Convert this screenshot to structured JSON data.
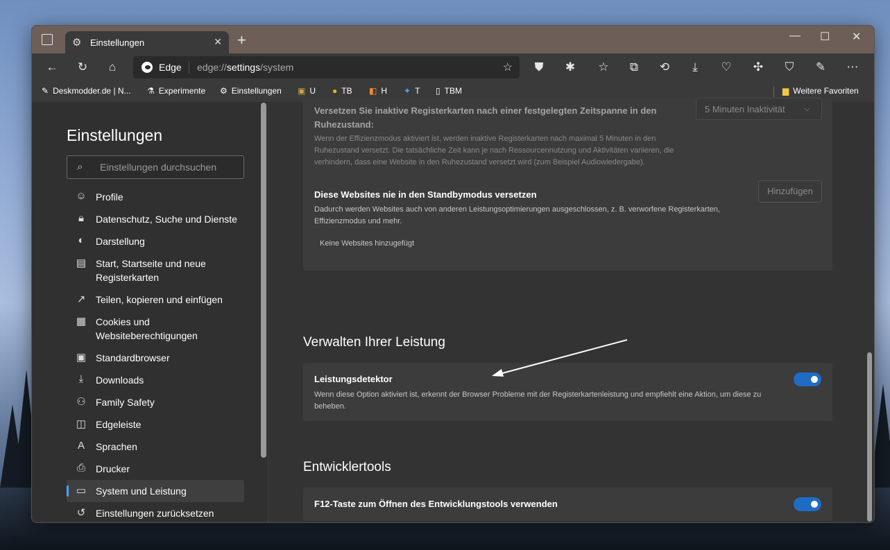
{
  "browser": {
    "tab_title": "Einstellungen",
    "window_controls": [
      "—",
      "☐",
      "✕"
    ],
    "address": {
      "brand": "Edge",
      "url_prefix": "edge://",
      "url_bold": "settings",
      "url_suffix": "/system"
    }
  },
  "favorites": [
    {
      "label": "Deskmodder.de | N...",
      "icon": "pen-icon"
    },
    {
      "label": "Experimente",
      "icon": "flask-icon"
    },
    {
      "label": "Einstellungen",
      "icon": "gear-icon"
    },
    {
      "label": "U",
      "icon": "extension-icon"
    },
    {
      "label": "TB",
      "icon": "coin-icon"
    },
    {
      "label": "H",
      "icon": "squares-icon"
    },
    {
      "label": "T",
      "icon": "twitter-icon"
    },
    {
      "label": "TBM",
      "icon": "page-icon"
    }
  ],
  "favorites_folder": "Weitere Favoriten",
  "sidebar": {
    "title": "Einstellungen",
    "search_placeholder": "Einstellungen durchsuchen",
    "items": [
      {
        "label": "Profile",
        "icon": "profile-icon"
      },
      {
        "label": "Datenschutz, Suche und Dienste",
        "icon": "lock-icon"
      },
      {
        "label": "Darstellung",
        "icon": "palette-icon"
      },
      {
        "label": "Start, Startseite und neue Registerkarten",
        "icon": "home-tabs-icon"
      },
      {
        "label": "Teilen, kopieren und einfügen",
        "icon": "share-icon"
      },
      {
        "label": "Cookies und Websiteberechtigungen",
        "icon": "cookie-icon"
      },
      {
        "label": "Standardbrowser",
        "icon": "browser-icon"
      },
      {
        "label": "Downloads",
        "icon": "download-icon"
      },
      {
        "label": "Family Safety",
        "icon": "family-icon"
      },
      {
        "label": "Edgeleiste",
        "icon": "sidebar-icon"
      },
      {
        "label": "Sprachen",
        "icon": "language-icon"
      },
      {
        "label": "Drucker",
        "icon": "printer-icon"
      },
      {
        "label": "System und Leistung",
        "icon": "laptop-icon",
        "active": true
      },
      {
        "label": "Einstellungen zurücksetzen",
        "icon": "reset-icon"
      }
    ]
  },
  "main": {
    "sleeping_tabs": {
      "title": "Versetzen Sie inaktive Registerkarten nach einer festgelegten Zeitspanne in den Ruhezustand:",
      "desc": "Wenn der Effizienzmodus aktiviert ist, werden inaktive Registerkarten nach maximal 5 Minuten in den Ruhezustand versetzt. Die tatsächliche Zeit kann je nach Ressourcennutzung und Aktivitäten variieren, die verhindern, dass eine Website in den Ruhezustand versetzt wird (zum Beispiel Audiowiedergabe).",
      "dropdown_value": "5 Minuten Inaktivität"
    },
    "never_sleep": {
      "title": "Diese Websites nie in den Standbymodus versetzen",
      "desc": "Dadurch werden Websites auch von anderen Leistungsoptimierungen ausgeschlossen, z. B. verworfene Registerkarten, Effizienzmodus und mehr.",
      "add_button": "Hinzufügen",
      "empty_text": "Keine Websites hinzugefügt"
    },
    "performance": {
      "heading": "Verwalten Ihrer Leistung",
      "title": "Leistungsdetektor",
      "desc": "Wenn diese Option aktiviert ist, erkennt der Browser Probleme mit der Registerkartenleistung und empfiehlt eine Aktion, um diese zu beheben.",
      "enabled": true
    },
    "devtools": {
      "heading": "Entwicklertools",
      "title": "F12-Taste zum Öffnen des Entwicklungstools verwenden",
      "enabled": true
    }
  },
  "colors": {
    "accent": "#1f6cc6",
    "tabbar": "#6d5e58",
    "background": "#333333"
  }
}
